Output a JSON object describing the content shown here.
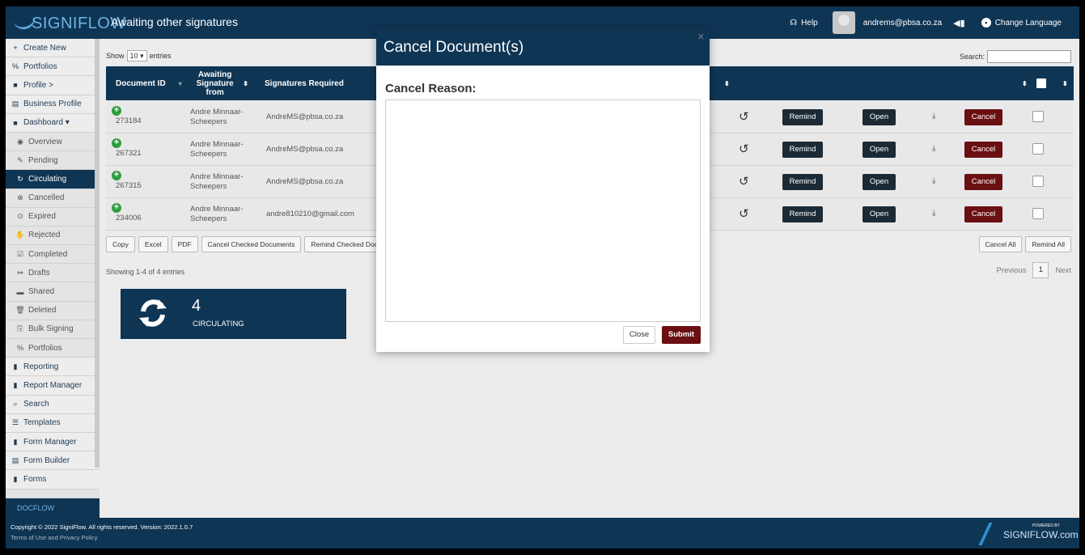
{
  "app": {
    "logo_text": "SIGNIFLOW",
    "page_title": "Awaiting other signatures"
  },
  "topbar": {
    "help": "Help",
    "user_email": "andrems@pbsa.co.za",
    "language": "Change Language"
  },
  "sidebar": {
    "items": [
      {
        "icon": "+",
        "label": "Create New"
      },
      {
        "icon": "%",
        "label": "Portfolios"
      },
      {
        "icon": "■",
        "label": "Profile >"
      },
      {
        "icon": "▤",
        "label": "Business Profile"
      },
      {
        "icon": "■",
        "label": "Dashboard ▾"
      },
      {
        "icon": "◉",
        "label": "Overview"
      },
      {
        "icon": "✎",
        "label": "Pending"
      },
      {
        "icon": "↻",
        "label": "Circulating"
      },
      {
        "icon": "⊗",
        "label": "Cancelled"
      },
      {
        "icon": "⊙",
        "label": "Expired"
      },
      {
        "icon": "✋",
        "label": "Rejected"
      },
      {
        "icon": "☑",
        "label": "Completed"
      },
      {
        "icon": "↦",
        "label": "Drafts"
      },
      {
        "icon": "▬",
        "label": "Shared"
      },
      {
        "icon": "🗑",
        "label": "Deleted"
      },
      {
        "icon": "⎘",
        "label": "Bulk Signing"
      },
      {
        "icon": "%",
        "label": "Portfolios"
      },
      {
        "icon": "▮",
        "label": "Reporting"
      },
      {
        "icon": "▮",
        "label": "Report Manager"
      },
      {
        "icon": "⌕",
        "label": "Search"
      },
      {
        "icon": "☰",
        "label": "Templates"
      },
      {
        "icon": "▮",
        "label": "Form Manager"
      },
      {
        "icon": "▤",
        "label": "Form Builder"
      },
      {
        "icon": "▮",
        "label": "Forms"
      }
    ],
    "docflow": "DOCFLOW"
  },
  "table": {
    "show_label_pre": "Show",
    "show_value": "10",
    "show_label_post": "entries",
    "search_label": "Search:",
    "headers": {
      "doc_id": "Document ID",
      "awaiting": "Awaiting Signature from",
      "signatures": "Signatures Required"
    },
    "rows": [
      {
        "id": "273184",
        "name": "Andre Minnaar-Scheepers",
        "email": "AndreMS@pbsa.co.za"
      },
      {
        "id": "267321",
        "name": "Andre Minnaar-Scheepers",
        "email": "AndreMS@pbsa.co.za"
      },
      {
        "id": "267315",
        "name": "Andre Minnaar-Scheepers",
        "email": "AndreMS@pbsa.co.za"
      },
      {
        "id": "234006",
        "name": "Andre Minnaar-Scheepers",
        "email": "andre810210@gmail.com"
      }
    ],
    "remind": "Remind",
    "open": "Open",
    "cancel": "Cancel",
    "toolbar": [
      "Copy",
      "Excel",
      "PDF",
      "Cancel Checked Documents",
      "Remind Checked Documen"
    ],
    "cancel_all": "Cancel All",
    "remind_all": "Remind All",
    "showing": "Showing 1-4 of 4 entries",
    "previous": "Previous",
    "page": "1",
    "next": "Next"
  },
  "stat": {
    "count": "4",
    "label": "CIRCULATING"
  },
  "footer": {
    "copyright": "Copyright © 2022 SigniFlow. All rights reserved. Version: 2022.1.0.7",
    "terms": "Terms of Use and Privacy Policy",
    "powered_small": "POWERED BY",
    "powered_big": "SIGNIFLOW.com"
  },
  "modal": {
    "title": "Cancel Document(s)",
    "reason_label": "Cancel Reason:",
    "reason_value": "",
    "close": "Close",
    "submit": "Submit"
  }
}
